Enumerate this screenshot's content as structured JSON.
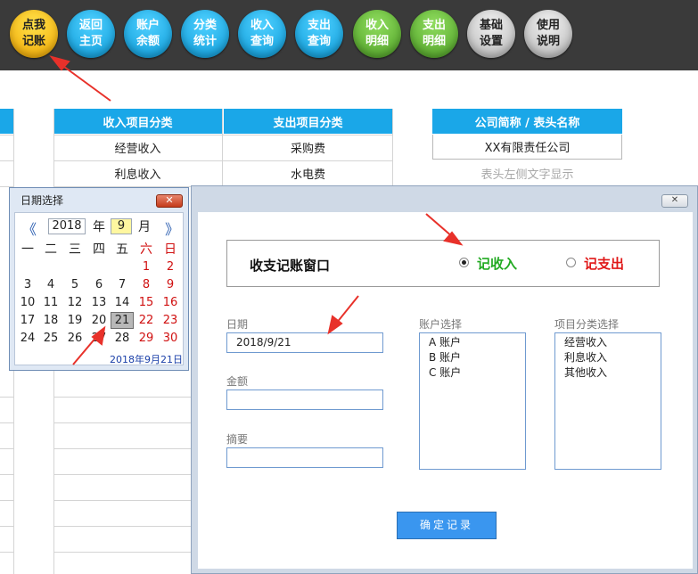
{
  "toolbar": {
    "buttons": [
      {
        "line1": "点我",
        "line2": "记账",
        "color": "yellow"
      },
      {
        "line1": "返回",
        "line2": "主页",
        "color": "blue"
      },
      {
        "line1": "账户",
        "line2": "余额",
        "color": "blue"
      },
      {
        "line1": "分类",
        "line2": "统计",
        "color": "blue"
      },
      {
        "line1": "收入",
        "line2": "查询",
        "color": "blue"
      },
      {
        "line1": "支出",
        "line2": "查询",
        "color": "blue"
      },
      {
        "line1": "收入",
        "line2": "明细",
        "color": "green"
      },
      {
        "line1": "支出",
        "line2": "明细",
        "color": "green"
      },
      {
        "line1": "基础",
        "line2": "设置",
        "color": "gray"
      },
      {
        "line1": "使用",
        "line2": "说明",
        "color": "gray"
      }
    ]
  },
  "sheet": {
    "income_header": "收入项目分类",
    "expense_header": "支出项目分类",
    "company_header": "公司简称 / 表头名称",
    "income_items": [
      "经营收入",
      "利息收入"
    ],
    "expense_items": [
      "采购费",
      "水电费"
    ],
    "company_name": "XX有限责任公司",
    "company_hint": "表头左侧文字显示"
  },
  "datepicker": {
    "title": "日期选择",
    "close": "✕",
    "year": "2018",
    "year_unit": "年",
    "month": "9",
    "month_unit": "月",
    "prev": "《",
    "next": "》",
    "weekdays": [
      "一",
      "二",
      "三",
      "四",
      "五",
      "六",
      "日"
    ],
    "days": [
      [
        "",
        "",
        "",
        "",
        "",
        "1",
        "2"
      ],
      [
        "3",
        "4",
        "5",
        "6",
        "7",
        "8",
        "9"
      ],
      [
        "10",
        "11",
        "12",
        "13",
        "14",
        "15",
        "16"
      ],
      [
        "17",
        "18",
        "19",
        "20",
        "21",
        "22",
        "23"
      ],
      [
        "24",
        "25",
        "26",
        "27",
        "28",
        "29",
        "30"
      ]
    ],
    "selected": "21",
    "footer": "2018年9月21日"
  },
  "dialog": {
    "close": "✕",
    "frame_title": "收支记账窗口",
    "radio_income": "记收入",
    "radio_expense": "记支出",
    "date_label": "日期",
    "date_value": "2018/9/21",
    "amount_label": "金额",
    "amount_value": "",
    "summary_label": "摘要",
    "summary_value": "",
    "account_label": "账户选择",
    "accounts": [
      "A 账户",
      "B 账户",
      "C 账户"
    ],
    "category_label": "项目分类选择",
    "categories": [
      "经营收入",
      "利息收入",
      "其他收入"
    ],
    "confirm": "确定记录"
  },
  "colors": {
    "header_blue": "#1aa7e8",
    "income_green": "#22aa22",
    "expense_red": "#e01818",
    "arrow_red": "#e8312a",
    "confirm_blue": "#3a96ef"
  }
}
